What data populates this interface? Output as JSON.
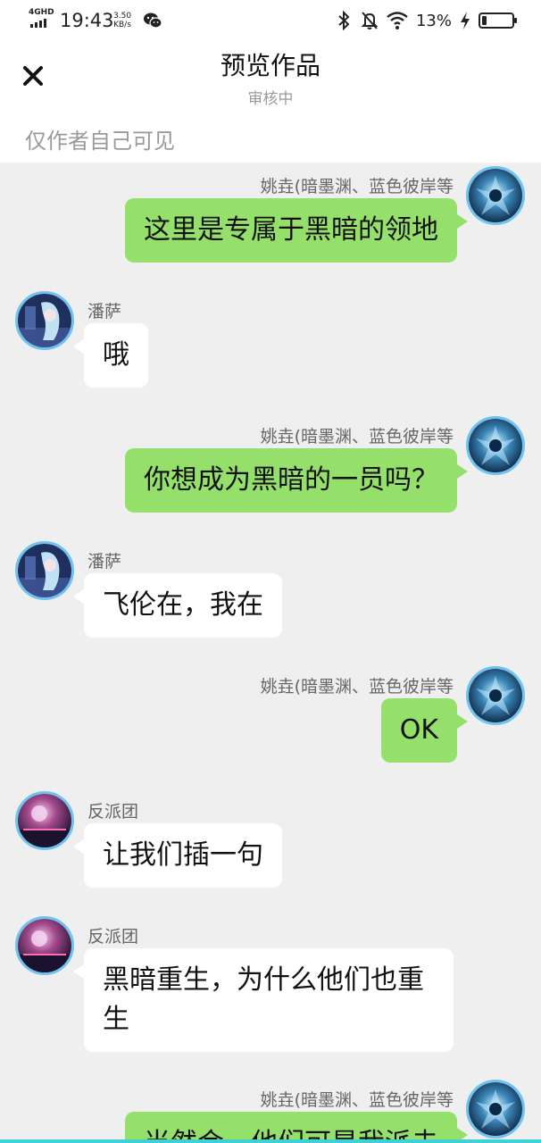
{
  "status_bar": {
    "network": "4GHD",
    "time": "19:43",
    "speed_value": "3.50",
    "speed_unit": "KB/s",
    "battery": "13%",
    "battery_level": 0.13,
    "icons": [
      "signal-icon",
      "wechat-icon",
      "bluetooth-icon",
      "mute-icon",
      "wifi-icon",
      "charging-icon",
      "battery-icon"
    ]
  },
  "header": {
    "title": "预览作品",
    "subtitle": "审核中",
    "visibility_note": "仅作者自己可见"
  },
  "messages": [
    {
      "side": "right",
      "avatar": "dark-blue-avatar",
      "sender": "姚垚(暗墨渊、蓝色彼岸等",
      "text": "这里是专属于黑暗的领地"
    },
    {
      "side": "left",
      "avatar": "anime-girl-avatar",
      "sender": "潘萨",
      "text": "哦"
    },
    {
      "side": "right",
      "avatar": "dark-blue-avatar",
      "sender": "姚垚(暗墨渊、蓝色彼岸等",
      "text": "你想成为黑暗的一员吗？"
    },
    {
      "side": "left",
      "avatar": "anime-girl-avatar",
      "sender": "潘萨",
      "text": "飞伦在，我在"
    },
    {
      "side": "right",
      "avatar": "dark-blue-avatar",
      "sender": "姚垚(暗墨渊、蓝色彼岸等",
      "text": "OK"
    },
    {
      "side": "left",
      "avatar": "galaxy-avatar",
      "sender": "反派团",
      "text": "让我们插一句"
    },
    {
      "side": "left",
      "avatar": "galaxy-avatar",
      "sender": "反派团",
      "text": "黑暗重生，为什么他们也重生"
    },
    {
      "side": "right",
      "avatar": "dark-blue-avatar",
      "sender": "姚垚(暗墨渊、蓝色彼岸等",
      "text": "当然会，他们可是我派去"
    }
  ],
  "colors": {
    "sent_bubble": "#95e06b",
    "received_bubble": "#ffffff",
    "background": "#efefef",
    "avatar_ring": "#6fc3ee"
  }
}
